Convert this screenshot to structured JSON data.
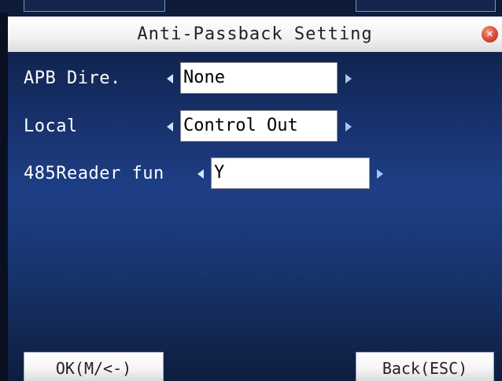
{
  "window": {
    "title": "Anti-Passback Setting",
    "close_icon": "close-icon",
    "close_glyph": "✕"
  },
  "settings": [
    {
      "label": "APB Dire.",
      "value": "None"
    },
    {
      "label": "Local",
      "value": "Control Out"
    },
    {
      "label": "485Reader fun",
      "value": "Y"
    }
  ],
  "footer": {
    "ok_label": "OK(M/<-)",
    "back_label": "Back(ESC)"
  },
  "colors": {
    "background": "#1e3f86",
    "title_bar": "#f2f2f2",
    "close_button": "#d54a33",
    "arrow": "#cfe3ff"
  }
}
